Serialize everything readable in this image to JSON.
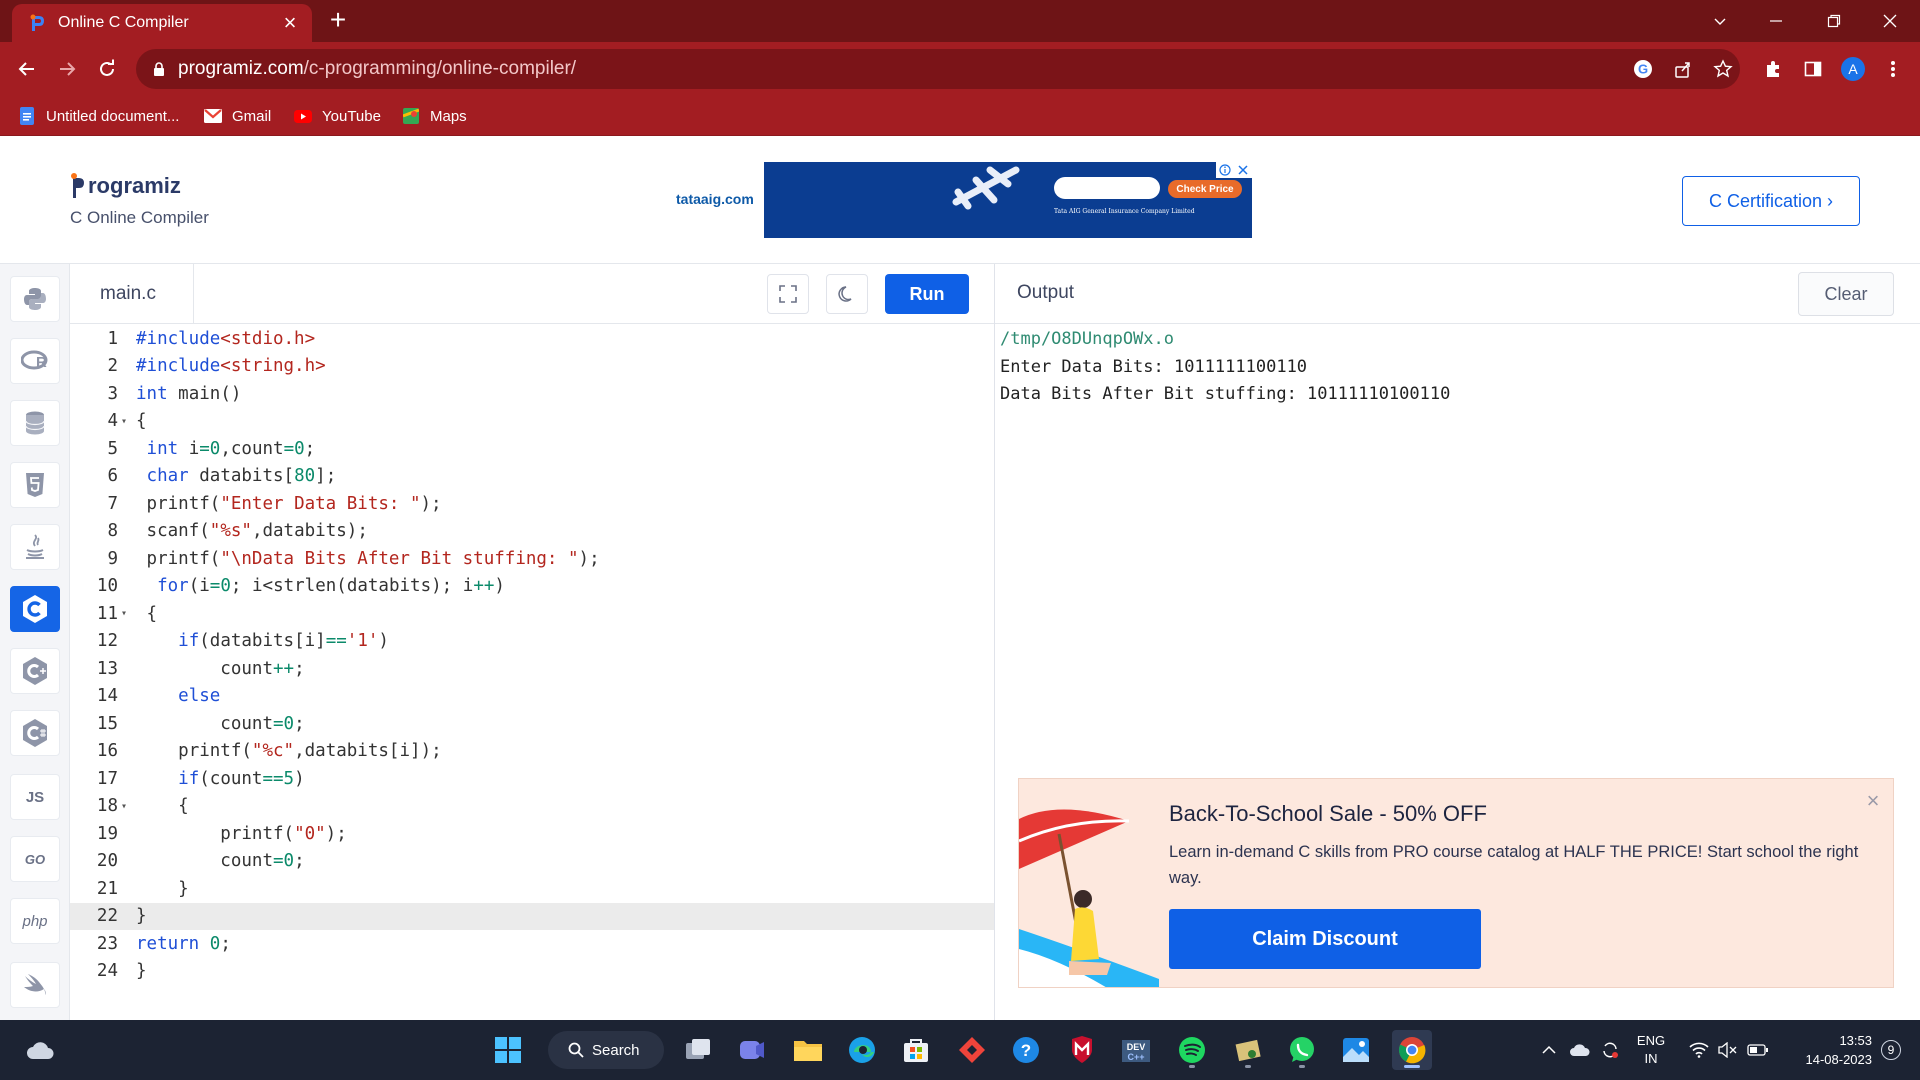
{
  "browser": {
    "tab_title": "Online C Compiler",
    "tab_close": "×",
    "new_tab": "+",
    "url_domain": "programiz.com",
    "url_path": "/c-programming/online-compiler/",
    "profile_initial": "A",
    "bookmarks": [
      {
        "label": "Untitled document..."
      },
      {
        "label": "Gmail"
      },
      {
        "label": "YouTube"
      },
      {
        "label": "Maps"
      }
    ]
  },
  "header": {
    "logo_text": "rogramiz",
    "subtitle": "C Online Compiler",
    "ad_sponsor": "tataaig.com",
    "ad_button": "Check Price",
    "ad_caption": "Tata AIG General Insurance Company Limited",
    "cert_button": "C Certification ›"
  },
  "sidebar": {
    "items": [
      "python",
      "r",
      "sql",
      "html",
      "java",
      "c",
      "cpp",
      "csharp",
      "JS",
      "GO",
      "php",
      "swift"
    ],
    "js_label": "JS",
    "go_label": "GO",
    "php_label": "php"
  },
  "editor": {
    "file_name": "main.c",
    "run_label": "Run",
    "highlighted_line": 22,
    "lines": [
      {
        "n": "1",
        "fold": "",
        "code": "#include<stdio.h>"
      },
      {
        "n": "2",
        "fold": "",
        "code": "#include<string.h>"
      },
      {
        "n": "3",
        "fold": "",
        "code": "int main()"
      },
      {
        "n": "4",
        "fold": "▾",
        "code": "{"
      },
      {
        "n": "5",
        "fold": "",
        "code": " int i=0,count=0;"
      },
      {
        "n": "6",
        "fold": "",
        "code": " char databits[80];"
      },
      {
        "n": "7",
        "fold": "",
        "code": " printf(\"Enter Data Bits: \");"
      },
      {
        "n": "8",
        "fold": "",
        "code": " scanf(\"%s\",databits);"
      },
      {
        "n": "9",
        "fold": "",
        "code": " printf(\"\\nData Bits After Bit stuffing: \");"
      },
      {
        "n": "10",
        "fold": "",
        "code": "  for(i=0; i<strlen(databits); i++)"
      },
      {
        "n": "11",
        "fold": "▾",
        "code": " {"
      },
      {
        "n": "12",
        "fold": "",
        "code": "    if(databits[i]=='1')"
      },
      {
        "n": "13",
        "fold": "",
        "code": "        count++;"
      },
      {
        "n": "14",
        "fold": "",
        "code": "    else"
      },
      {
        "n": "15",
        "fold": "",
        "code": "        count=0;"
      },
      {
        "n": "16",
        "fold": "",
        "code": "    printf(\"%c\",databits[i]);"
      },
      {
        "n": "17",
        "fold": "",
        "code": "    if(count==5)"
      },
      {
        "n": "18",
        "fold": "▾",
        "code": "    {"
      },
      {
        "n": "19",
        "fold": "",
        "code": "        printf(\"0\");"
      },
      {
        "n": "20",
        "fold": "",
        "code": "        count=0;"
      },
      {
        "n": "21",
        "fold": "",
        "code": "    }"
      },
      {
        "n": "22",
        "fold": "",
        "code": "}"
      },
      {
        "n": "23",
        "fold": "",
        "code": "return 0;"
      },
      {
        "n": "24",
        "fold": "",
        "code": "}"
      }
    ]
  },
  "output": {
    "label": "Output",
    "clear_label": "Clear",
    "path_line": "/tmp/O8DUnqpOWx.o",
    "lines": [
      "Enter Data Bits: 1011111100110",
      "Data Bits After Bit stuffing: 10111110100110"
    ]
  },
  "promo": {
    "title": "Back-To-School Sale - 50% OFF",
    "body": "Learn in-demand C skills from PRO course catalog at HALF THE PRICE! Start school the right way.",
    "cta": "Claim Discount",
    "close": "×"
  },
  "taskbar": {
    "search_label": "Search",
    "lang_top": "ENG",
    "lang_bottom": "IN",
    "time": "13:53",
    "date": "14-08-2023",
    "notification_count": "9"
  },
  "colors": {
    "chrome_dark": "#6e1416",
    "chrome": "#a31d22",
    "accent": "#0f60e6",
    "keyword": "#1f4fd6",
    "string": "#b3261e",
    "number": "#0b8a6a",
    "promo_bg": "#fde8de"
  }
}
